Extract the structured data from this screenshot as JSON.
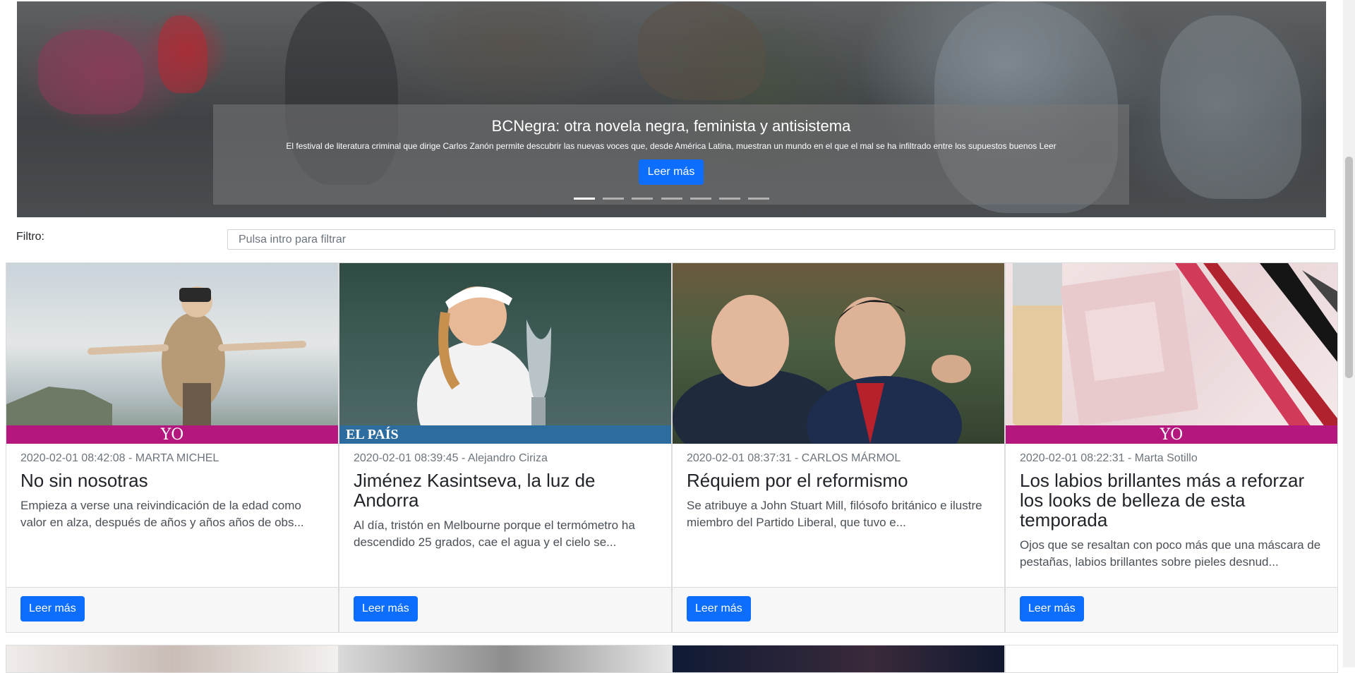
{
  "hero": {
    "title": "BCNegra: otra novela negra, feminista y antisistema",
    "text": "El festival de literatura criminal que dirige Carlos Zanón permite descubrir las nuevas voces que, desde América Latina, muestran un mundo en el que el mal se ha infiltrado entre los supuestos buenos Leer",
    "button_label": "Leer más",
    "slide_count": 7,
    "active_slide": 1
  },
  "filter": {
    "label": "Filtro:",
    "placeholder": "Pulsa intro para filtrar",
    "value": ""
  },
  "cards": [
    {
      "source": "yo",
      "source_label": "YO",
      "meta": "2020-02-01 08:42:08 - MARTA MICHEL",
      "title": "No sin nosotras",
      "text": "Empieza a verse una reivindicación de la edad como valor en alza, después de años y años años de obs...",
      "button_label": "Leer más"
    },
    {
      "source": "elpais",
      "source_label": "EL PAÍS",
      "meta": "2020-02-01 08:39:45 - Alejandro Ciriza",
      "title": "Jiménez Kasintseva, la luz de Andorra",
      "text": "Al día, tristón en Melbourne porque el termómetro ha descendido 25 grados, cae el agua y el cielo se...",
      "button_label": "Leer más"
    },
    {
      "source": "none",
      "source_label": "",
      "meta": "2020-02-01 08:37:31 - CARLOS MÁRMOL",
      "title": "Réquiem por el reformismo",
      "text": "Se atribuye a John Stuart Mill, filósofo británico e ilustre miembro del Partido Liberal, que tuvo e...",
      "button_label": "Leer más"
    },
    {
      "source": "yo",
      "source_label": "YO",
      "meta": "2020-02-01 08:22:31 - Marta Sotillo",
      "title": "Los labios brillantes más a reforzar los looks de belleza de esta temporada",
      "text": "Ojos que se resaltan con poco más que una máscara de pestañas, labios brillantes sobre pieles desnud...",
      "button_label": "Leer más"
    }
  ],
  "colors": {
    "primary_button": "#0d6efd",
    "yo_brand": "#b4187e",
    "elpais_brand": "#2c6c9e"
  }
}
